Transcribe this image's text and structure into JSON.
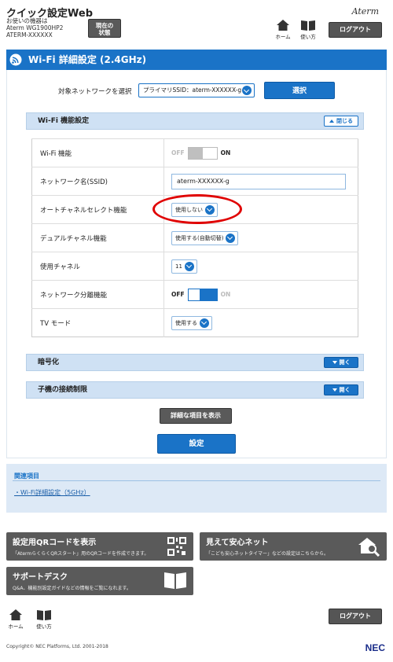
{
  "header": {
    "app_title": "クイック設定Web",
    "device_label": "お使いの機器は",
    "device_model": "Aterm WG1900HP2",
    "device_name": "ATERM-XXXXXX",
    "status_button": [
      "現在の",
      "状態"
    ],
    "home_label": "ホーム",
    "help_label": "使い方",
    "logo": "Aterm",
    "logout_label": "ログアウト"
  },
  "page": {
    "title": "Wi-Fi 詳細設定 (2.4GHz)",
    "target_network_label": "対象ネットワークを選択",
    "target_network_value": "プライマリSSID：aterm-XXXXXX-g",
    "select_button": "選択"
  },
  "wifi_section": {
    "title": "Wi-Fi 機能設定",
    "collapse_label": "閉じる",
    "rows": [
      {
        "label": "Wi-Fi 機能",
        "off": "OFF",
        "on": "ON",
        "state": "on"
      },
      {
        "label": "ネットワーク名(SSID)",
        "value": "aterm-XXXXXX-g"
      },
      {
        "label": "オートチャネルセレクト機能",
        "value": "使用しない"
      },
      {
        "label": "デュアルチャネル機能",
        "value": "使用する(自動切替)"
      },
      {
        "label": "使用チャネル",
        "value": "11"
      },
      {
        "label": "ネットワーク分離機能",
        "off": "OFF",
        "on": "ON",
        "state": "off"
      },
      {
        "label": "TV モード",
        "value": "使用する"
      }
    ]
  },
  "encryption_section": {
    "title": "暗号化",
    "expand_label": "開く"
  },
  "client_limit_section": {
    "title": "子機の接続制限",
    "expand_label": "開く"
  },
  "detail_button": "詳細な項目を表示",
  "apply_button": "設定",
  "related": {
    "title": "関連項目",
    "link": "Wi-Fi詳細設定（5GHz）"
  },
  "tiles": [
    {
      "title": "設定用QRコードを表示",
      "desc": "「AtermらくらくQRスタート」用のQRコードを作成できます。",
      "icon": "qr-code-icon"
    },
    {
      "title": "見えて安心ネット",
      "desc": "「こども安心ネットタイマー」などの設定はこちらから。",
      "icon": "house-search-icon"
    },
    {
      "title": "サポートデスク",
      "desc": "Q&A、機能別設定ガイドなどの情報をご覧になれます。",
      "icon": "open-book-icon"
    }
  ],
  "footer": {
    "home_label": "ホーム",
    "help_label": "使い方",
    "logout_label": "ログアウト",
    "copyright": "Copyright© NEC Platforms, Ltd. 2001-2018",
    "brand": "NEC"
  },
  "colors": {
    "accent": "#1a73c7",
    "section_bg": "#cfe1f4",
    "dark_button": "#5a5a5a",
    "highlight": "#e00000"
  }
}
